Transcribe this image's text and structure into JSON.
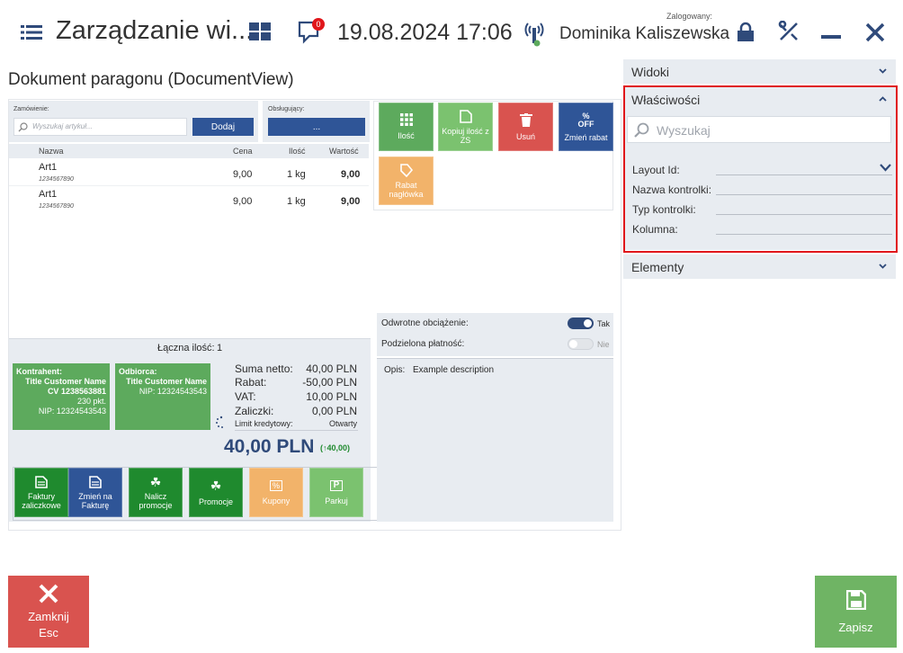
{
  "header": {
    "title": "Zarządzanie wi...",
    "notification_count": "0",
    "datetime": "19.08.2024 17:06",
    "logged_label": "Zalogowany:",
    "user_name": "Dominika Kaliszewska"
  },
  "document": {
    "title": "Dokument paragonu (DocumentView)",
    "order_label": "Zamówienie:",
    "search_placeholder": "Wyszukaj artykuł...",
    "add_label": "Dodaj",
    "served_label": "Obsługujący:",
    "served_value": "...",
    "columns": {
      "name": "Nazwa",
      "price": "Cena",
      "qty": "Ilość",
      "value": "Wartość"
    },
    "items": [
      {
        "name": "Art1",
        "code": "1234567890",
        "price": "9,00",
        "qty": "1 kg",
        "value": "9,00"
      },
      {
        "name": "Art1",
        "code": "1234567890",
        "price": "9,00",
        "qty": "1 kg",
        "value": "9,00"
      }
    ],
    "total_qty_label": "Łączna ilość:",
    "total_qty": "1"
  },
  "actions": {
    "qty": "Ilość",
    "copy_qty": "Kopiuj ilość z ZS",
    "delete": "Usuń",
    "change_discount": "Zmień rabat",
    "off_line1": "%",
    "off_line2": "OFF",
    "header_discount": "Rabat nagłówka"
  },
  "options": {
    "reverse_charge_label": "Odwrotne obciążenie:",
    "reverse_charge_value": "Tak",
    "split_payment_label": "Podzielona płatność:",
    "split_payment_value": "Nie",
    "desc_label": "Opis:",
    "desc_value": "Example description"
  },
  "contractor": {
    "label": "Kontrahent:",
    "name": "Title Customer Name",
    "code": "CV 1238563881",
    "points": "230 pkt.",
    "nip": "NIP: 12324543543"
  },
  "recipient": {
    "label": "Odbiorca:",
    "name": "Title Customer Name",
    "nip": "NIP: 12324543543"
  },
  "summary": {
    "net_label": "Suma netto:",
    "net_value": "40,00 PLN",
    "discount_label": "Rabat:",
    "discount_value": "-50,00 PLN",
    "vat_label": "VAT:",
    "vat_value": "10,00 PLN",
    "advances_label": "Zaliczki:",
    "advances_value": "0,00 PLN",
    "credit_label": "Limit kredytowy:",
    "credit_value": "Otwarty",
    "total": "40,00 PLN",
    "total_sub": "(↑40,00)"
  },
  "bottom_actions": {
    "advance_invoices": "Faktury zaliczkowe",
    "to_invoice": "Zmień na Fakturę",
    "calc_promo": "Nalicz promocje",
    "promo": "Promocje",
    "coupons": "Kupony",
    "park": "Parkuj"
  },
  "right_panel": {
    "views": "Widoki",
    "properties": "Właściwości",
    "search_placeholder": "Wyszukaj",
    "layout_id": "Layout Id:",
    "control_name": "Nazwa kontrolki:",
    "control_type": "Typ kontrolki:",
    "column": "Kolumna:",
    "elements": "Elementy"
  },
  "footer": {
    "close_label": "Zamknij",
    "close_key": "Esc",
    "save_label": "Zapisz"
  },
  "colors": {
    "accent_blue": "#2f5597",
    "green": "#5daa5d",
    "red": "#d9534f",
    "highlight_red": "#e0161b"
  }
}
